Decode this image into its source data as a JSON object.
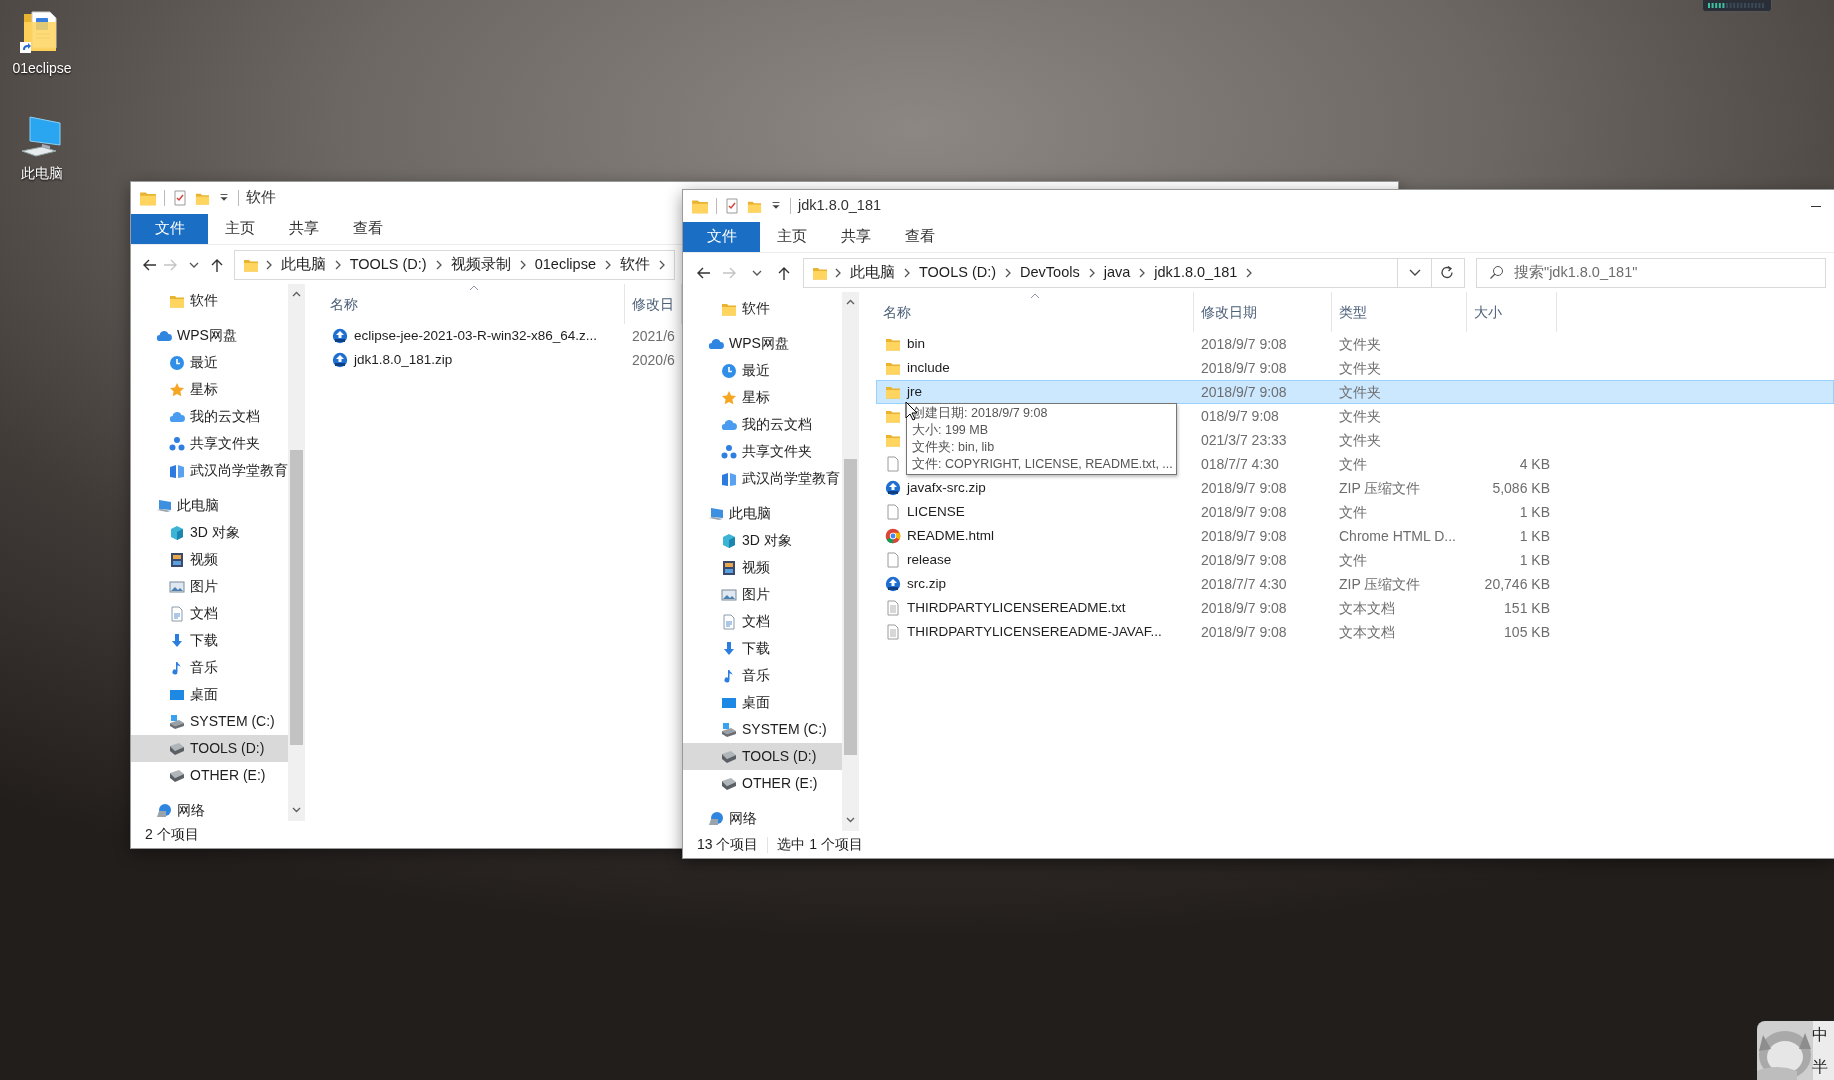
{
  "desktop_icons": [
    {
      "label": "01eclipse",
      "kind": "shortcut_folder"
    },
    {
      "label": "此电脑",
      "kind": "computer"
    }
  ],
  "windows": [
    {
      "title": "软件",
      "forward": {
        "disabled": true
      },
      "ribbon_tabs": [
        {
          "label": "文件",
          "kind": "file"
        },
        {
          "label": "主页",
          "kind": "tab"
        },
        {
          "label": "共享",
          "kind": "tab"
        },
        {
          "label": "查看",
          "kind": "tab"
        }
      ],
      "breadcrumbs": [
        "此电脑",
        "TOOLS (D:)",
        "视频录制",
        "01eclipse",
        "软件"
      ],
      "nav_pane": [
        {
          "label": "软件",
          "kind": "folder",
          "selected": false
        },
        {
          "label": "WPS网盘",
          "kind": "cloud",
          "selected": false,
          "children": [
            {
              "label": "最近",
              "kind": "recent",
              "selected": false
            },
            {
              "label": "星标",
              "kind": "star",
              "selected": false
            },
            {
              "label": "我的云文档",
              "kind": "cloud_doc",
              "selected": false
            },
            {
              "label": "共享文件夹",
              "kind": "shared",
              "selected": false
            },
            {
              "label": "武汉尚学堂教育",
              "kind": "book",
              "selected": false
            }
          ]
        },
        {
          "label": "此电脑",
          "kind": "computer",
          "selected": false,
          "children": [
            {
              "label": "3D 对象",
              "kind": "cube",
              "selected": false
            },
            {
              "label": "视频",
              "kind": "video",
              "selected": false
            },
            {
              "label": "图片",
              "kind": "pictures",
              "selected": false
            },
            {
              "label": "文档",
              "kind": "documents",
              "selected": false
            },
            {
              "label": "下载",
              "kind": "downloads",
              "selected": false
            },
            {
              "label": "音乐",
              "kind": "music",
              "selected": false
            },
            {
              "label": "桌面",
              "kind": "desktop",
              "selected": false
            },
            {
              "label": "SYSTEM (C:)",
              "kind": "system_drive",
              "selected": false
            },
            {
              "label": "TOOLS (D:)",
              "kind": "drive",
              "selected": true
            },
            {
              "label": "OTHER (E:)",
              "kind": "drive",
              "selected": false
            }
          ]
        },
        {
          "label": "网络",
          "kind": "network",
          "selected": false
        }
      ],
      "columns": [
        {
          "label": "名称",
          "kind": "name",
          "sorted": true
        },
        {
          "label": "修改日",
          "kind": "modified",
          "sorted": false
        }
      ],
      "files": [
        {
          "kind": "zip",
          "name": "eclipse-jee-2021-03-R-win32-x86_64.z...",
          "modified": "2021/6",
          "selected": false
        },
        {
          "kind": "zip",
          "name": "jdk1.8.0_181.zip",
          "modified": "2020/6",
          "selected": false
        }
      ],
      "status": [
        "2 个项目"
      ]
    },
    {
      "title": "jdk1.8.0_181",
      "forward": {
        "disabled": true
      },
      "ribbon_tabs": [
        {
          "label": "文件",
          "kind": "file"
        },
        {
          "label": "主页",
          "kind": "tab"
        },
        {
          "label": "共享",
          "kind": "tab"
        },
        {
          "label": "查看",
          "kind": "tab"
        }
      ],
      "breadcrumbs": [
        "此电脑",
        "TOOLS (D:)",
        "DevTools",
        "java",
        "jdk1.8.0_181"
      ],
      "search": {
        "placeholder": "搜索\"jdk1.8.0_181\""
      },
      "nav_pane": [
        {
          "label": "软件",
          "kind": "folder",
          "selected": false
        },
        {
          "label": "WPS网盘",
          "kind": "cloud",
          "selected": false,
          "children": [
            {
              "label": "最近",
              "kind": "recent",
              "selected": false
            },
            {
              "label": "星标",
              "kind": "star",
              "selected": false
            },
            {
              "label": "我的云文档",
              "kind": "cloud_doc",
              "selected": false
            },
            {
              "label": "共享文件夹",
              "kind": "shared",
              "selected": false
            },
            {
              "label": "武汉尚学堂教育",
              "kind": "book",
              "selected": false
            }
          ]
        },
        {
          "label": "此电脑",
          "kind": "computer",
          "selected": false,
          "children": [
            {
              "label": "3D 对象",
              "kind": "cube",
              "selected": false
            },
            {
              "label": "视频",
              "kind": "video",
              "selected": false
            },
            {
              "label": "图片",
              "kind": "pictures",
              "selected": false
            },
            {
              "label": "文档",
              "kind": "documents",
              "selected": false
            },
            {
              "label": "下载",
              "kind": "downloads",
              "selected": false
            },
            {
              "label": "音乐",
              "kind": "music",
              "selected": false
            },
            {
              "label": "桌面",
              "kind": "desktop",
              "selected": false
            },
            {
              "label": "SYSTEM (C:)",
              "kind": "system_drive",
              "selected": false
            },
            {
              "label": "TOOLS (D:)",
              "kind": "drive",
              "selected": true
            },
            {
              "label": "OTHER (E:)",
              "kind": "drive",
              "selected": false
            }
          ]
        },
        {
          "label": "网络",
          "kind": "network",
          "selected": false
        }
      ],
      "columns": [
        {
          "label": "名称",
          "kind": "name",
          "sorted": true
        },
        {
          "label": "修改日期",
          "kind": "modified",
          "sorted": false
        },
        {
          "label": "类型",
          "kind": "type",
          "sorted": false
        },
        {
          "label": "大小",
          "kind": "size",
          "sorted": false
        }
      ],
      "files": [
        {
          "kind": "folder",
          "name": "bin",
          "modified": "2018/9/7 9:08",
          "type": "文件夹",
          "selected": false
        },
        {
          "kind": "folder",
          "name": "include",
          "modified": "2018/9/7 9:08",
          "type": "文件夹",
          "selected": false
        },
        {
          "kind": "folder",
          "name": "jre",
          "modified": "2018/9/7 9:08",
          "type": "文件夹",
          "selected": true
        },
        {
          "kind": "folder",
          "modified": "018/9/7 9:08",
          "type": "文件夹",
          "selected": false
        },
        {
          "kind": "folder",
          "modified": "021/3/7 23:33",
          "type": "文件夹",
          "selected": false
        },
        {
          "kind": "file",
          "modified": "018/7/7 4:30",
          "type": "文件",
          "size": "4 KB",
          "selected": false
        },
        {
          "kind": "zip",
          "name": "javafx-src.zip",
          "modified": "2018/9/7 9:08",
          "type": "ZIP 压缩文件",
          "size": "5,086 KB",
          "selected": false
        },
        {
          "kind": "file",
          "name": "LICENSE",
          "modified": "2018/9/7 9:08",
          "type": "文件",
          "size": "1 KB",
          "selected": false
        },
        {
          "kind": "chrome",
          "name": "README.html",
          "modified": "2018/9/7 9:08",
          "type": "Chrome HTML D...",
          "size": "1 KB",
          "selected": false
        },
        {
          "kind": "file",
          "name": "release",
          "modified": "2018/9/7 9:08",
          "type": "文件",
          "size": "1 KB",
          "selected": false
        },
        {
          "kind": "zip",
          "name": "src.zip",
          "modified": "2018/7/7 4:30",
          "type": "ZIP 压缩文件",
          "size": "20,746 KB",
          "selected": false
        },
        {
          "kind": "text",
          "name": "THIRDPARTYLICENSEREADME.txt",
          "modified": "2018/9/7 9:08",
          "type": "文本文档",
          "size": "151 KB",
          "selected": false
        },
        {
          "kind": "text",
          "name": "THIRDPARTYLICENSEREADME-JAVAF...",
          "modified": "2018/9/7 9:08",
          "type": "文本文档",
          "size": "105 KB",
          "selected": false
        }
      ],
      "tooltip": [
        "创建日期: 2018/9/7 9:08",
        "大小: 199 MB",
        "文件夹: bin, lib",
        "文件: COPYRIGHT, LICENSE, README.txt, ..."
      ],
      "status": [
        "13 个项目",
        "选中 1 个项目"
      ]
    }
  ],
  "ime": {
    "mode": "中",
    "width": "半"
  }
}
